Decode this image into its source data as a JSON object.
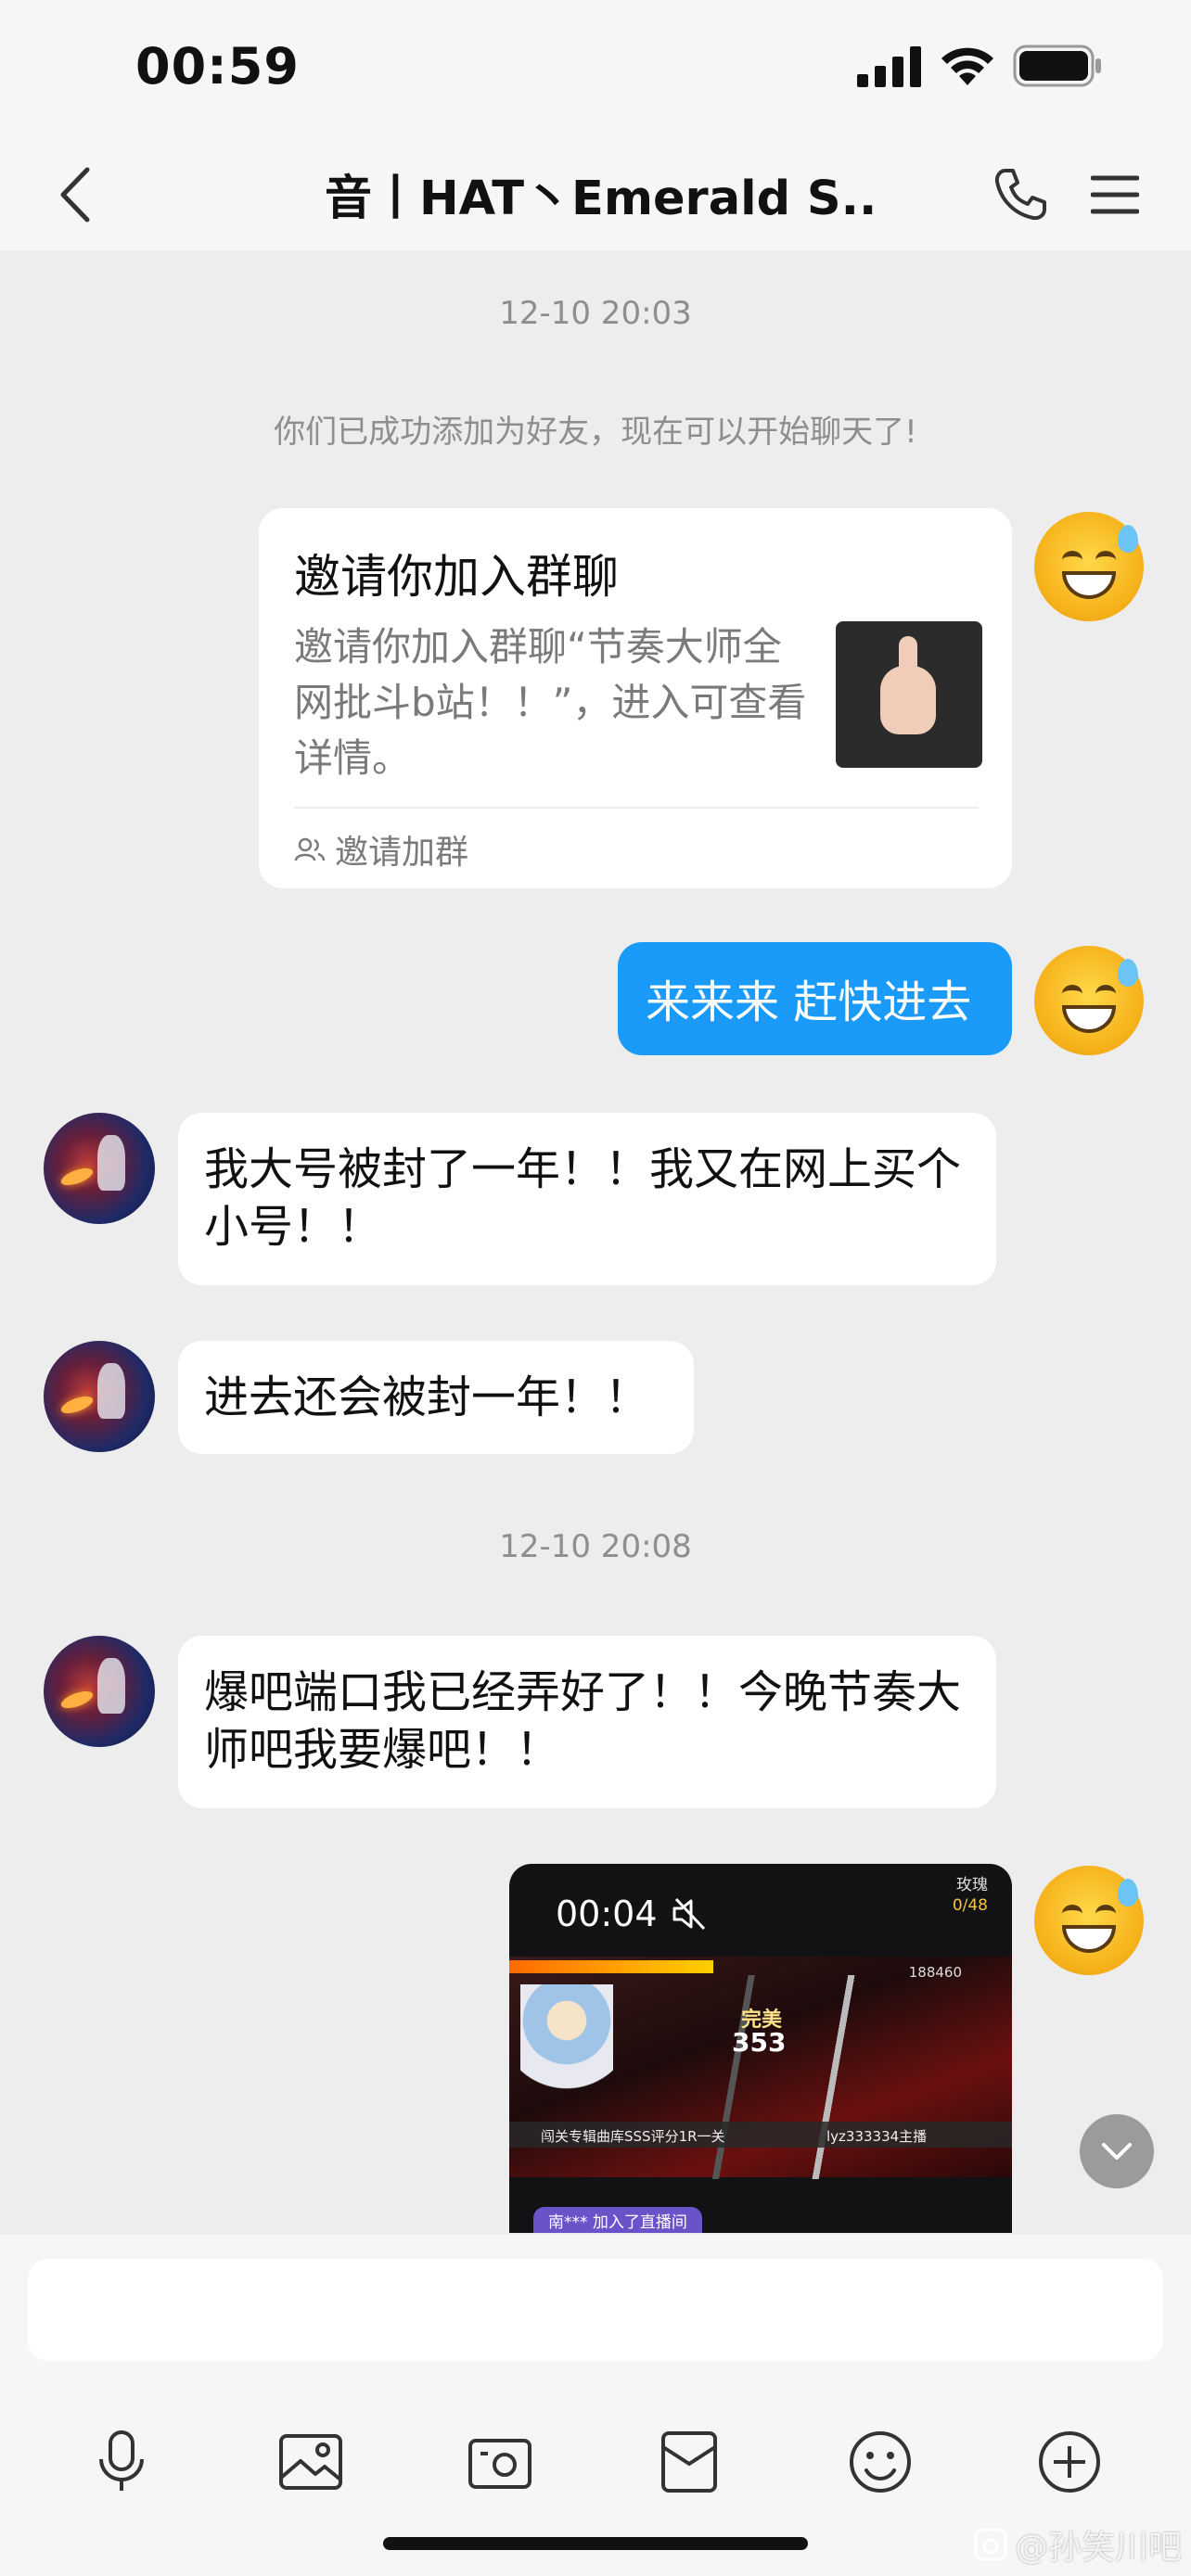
{
  "status_bar": {
    "time": "00:59"
  },
  "header": {
    "title": "音丨HAT丶Emerald S..."
  },
  "timestamps": [
    "12-10 20:03",
    "12-10 20:08"
  ],
  "system_message": "你们已成功添加为好友，现在可以开始聊天了!",
  "invite_card": {
    "title": "邀请你加入群聊",
    "description": "邀请你加入群聊“节奏大师全网批斗b站！！”，进入可查看详情。",
    "footer": "邀请加群"
  },
  "messages": [
    {
      "sender": "me",
      "text": "来来来 赶快进去"
    },
    {
      "sender": "other",
      "text": "我大号被封了一年！！我又在网上买个小号！！"
    },
    {
      "sender": "other",
      "text": "进去还会被封一年！！"
    },
    {
      "sender": "other",
      "text": "爆吧端口我已经弄好了！！今晚节奏大师吧我要爆吧！！"
    }
  ],
  "video": {
    "duration": "00:04",
    "rose_label": "玫瑰",
    "rose_count": "0/48",
    "score_top": "188460",
    "perfect": "完美",
    "combo": "353",
    "banner_left": "闯关专辑曲库SSS评分1R一关",
    "banner_right": "lyz333334主播",
    "ticker": "南*** 加入了直播间"
  },
  "input": {
    "placeholder": ""
  },
  "watermark": "@孙笑川吧",
  "colors": {
    "my_bubble": "#1a9bfa",
    "background": "#ededed"
  }
}
